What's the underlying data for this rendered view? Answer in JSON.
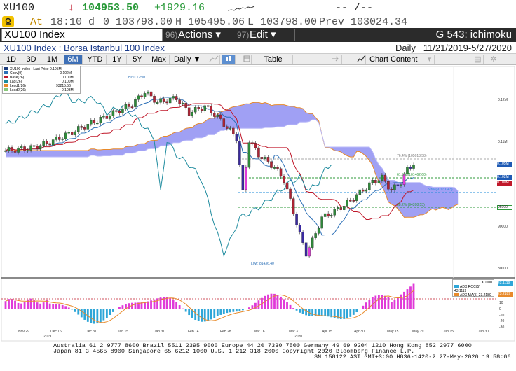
{
  "ticker": {
    "symbol": "XU100",
    "arrow": "↓",
    "last": "104953.50",
    "change": "+1929.16",
    "dashes": "-- /--",
    "at_label": "At",
    "time": "18:10 d",
    "open": "0 103798.00",
    "high": "H 105495.06",
    "low": "L 103798.00",
    "prev": "Prev 103024.34"
  },
  "header": {
    "title": "XU100 Index",
    "actions_num": "96)",
    "actions_label": "Actions ▾",
    "edit_num": "97)",
    "edit_label": "Edit ▾",
    "right_title": "G 543: ichimoku"
  },
  "subheader": {
    "security": "XU100 Index : Borsa Istanbul 100 Index",
    "period": "Daily",
    "range": "11/21/2019-5/27/2020"
  },
  "toolbar": {
    "buttons": [
      "1D",
      "3D",
      "1M",
      "6M",
      "YTD",
      "1Y",
      "5Y",
      "Max"
    ],
    "active": "6M",
    "frequency": "Daily ▼",
    "table_label": "Table",
    "chart_content_label": "Chart Content"
  },
  "legend": {
    "items": [
      {
        "label": "XU100 Index - Last Price 0.105M",
        "value": "",
        "color": "#ffffff"
      },
      {
        "label": "Conv(9)",
        "value": "0.102M",
        "color": "#2b6fb6"
      },
      {
        "label": "Base(26)",
        "value": "0.100M",
        "color": "#c0182a"
      },
      {
        "label": "Lag(26)",
        "value": "0.100M",
        "color": "#1e8b9e"
      },
      {
        "label": "Lead1(26)",
        "value": "93215.56",
        "color": "#e88a2a"
      },
      {
        "label": "Lead2(26)",
        "value": "0.103M",
        "color": "#88c87a"
      }
    ]
  },
  "annotations": {
    "high": "Hi: 0.125M",
    "low": "Low: 81436.40",
    "fib1": "76.4% (105013.58)",
    "fib2": "61.8% (101462.60)",
    "fib3": "50% (97931.43)",
    "fib4": "38.2% (94398.53)"
  },
  "price_axis": {
    "labels": [
      "0.12M",
      "0.11M",
      "0.105M",
      "0.102M",
      "0.100M",
      "95000",
      "90000",
      "80000"
    ]
  },
  "adx_panel": {
    "title": "XU100",
    "roc_label": "ADX ROC(5)",
    "roc_value": "43.1119",
    "ma_label": "ADX MA(5)",
    "ma_value": "23.2189",
    "axis": [
      "43.1119",
      "23.2189",
      "10",
      "0",
      "-10",
      "-20",
      "-30"
    ]
  },
  "x_axis": {
    "labels": [
      "Nov 29",
      "Dec 16",
      "Dec 31",
      "Jan 15",
      "Jan 31",
      "Feb 14",
      "Feb 28",
      "Mar 16",
      "Mar 31",
      "Apr 15",
      "Apr 30",
      "May 15",
      "May 29",
      "Jun 15",
      "Jun 30"
    ],
    "years": [
      "2019",
      "2020"
    ]
  },
  "footer": {
    "line1": "Australia 61 2 9777 8600  Brazil 5511 2395 9000  Europe 44 20 7330 7500  Germany 49 69 9204 1210  Hong Kong 852 2977 6000",
    "line2": "Japan 81 3 4565 8900        Singapore 65 6212 1000        U.S. 1 212 318 2000           Copyright 2020 Bloomberg Finance L.P.",
    "line3": "SN 158122 AST  GMT+3:00 H836-1420-2 27-May-2020 19:58:06"
  },
  "colors": {
    "cloud": "#8f8ff2",
    "up": "#2e8b3a",
    "down": "#b02435",
    "magenta": "#e03ad8",
    "conv": "#2b6fb6",
    "base": "#c0182a",
    "lag": "#1e8b9e",
    "lead1": "#e88a2a",
    "hist_blue": "#2ea6d8",
    "hist_magenta": "#e03ad8"
  }
}
